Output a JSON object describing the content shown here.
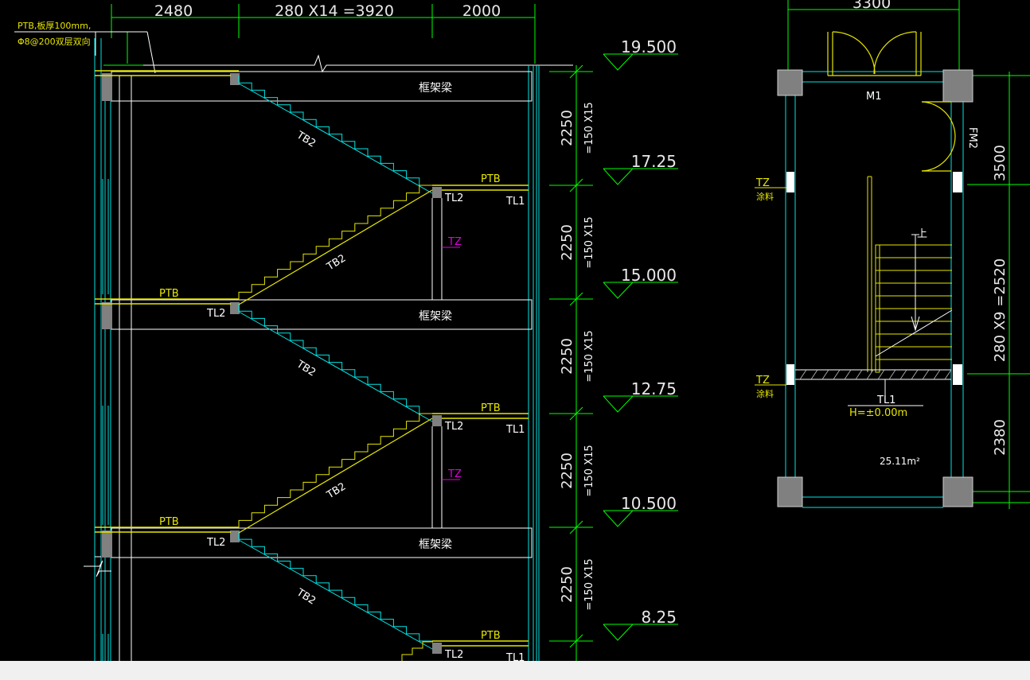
{
  "drawing": {
    "top_dimensions": [
      "2480",
      "280 X14 =3920",
      "2000"
    ],
    "plan_top_dimension": "3300",
    "note_line1": "PTB,板厚100mm,",
    "note_line2": "Φ8@200双层双向",
    "elevations": [
      "19.500",
      "17.25",
      "15.000",
      "12.75",
      "10.500",
      "8.25"
    ],
    "flight_dimensions": [
      {
        "height": "2250",
        "steps": "=150 X15"
      },
      {
        "height": "2250",
        "steps": "=150 X15"
      },
      {
        "height": "2250",
        "steps": "=150 X15"
      },
      {
        "height": "2250",
        "steps": "=150 X15"
      },
      {
        "height": "2250",
        "steps": "=150 X15"
      }
    ],
    "labels": {
      "frame_beam": "框架梁",
      "stair_slab": "TB2",
      "platform_slab": "PTB",
      "beam_tl1": "TL1",
      "beam_tl2": "TL2",
      "column_tz": "TZ",
      "door_m1": "M1",
      "door_fm2": "FM2",
      "tz_note": "TZ",
      "tz_note2": "涂料",
      "up_mark": "上",
      "tl1_plan": "TL1",
      "floor_height": "H=±0.00m",
      "area": "25.11m²"
    },
    "plan_right_dimensions": [
      "3500",
      "280 X9 =2520",
      "2380"
    ],
    "colors": {
      "background": "#000000",
      "wall_cyan": "#00e5e5",
      "dim_green": "#00ff00",
      "slab_yellow": "#e6e600",
      "label_magenta": "#e000e0",
      "column_gray": "#808080",
      "status_bar": "#f0f0f0"
    }
  }
}
